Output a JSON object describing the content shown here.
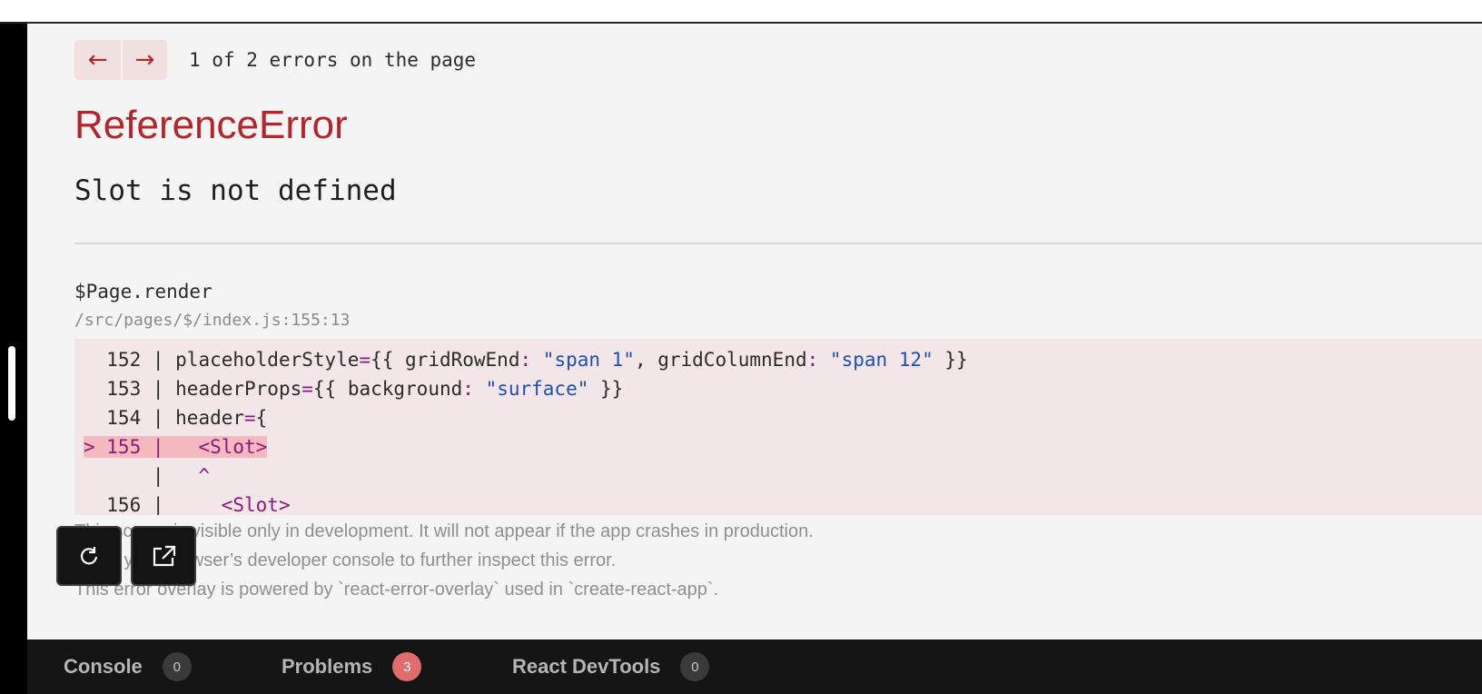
{
  "navigation": {
    "prev_symbol": "←",
    "next_symbol": "→",
    "status": "1 of 2 errors on the page"
  },
  "error": {
    "type": "ReferenceError",
    "message": "Slot is not defined"
  },
  "frame": {
    "function": "$Page.render",
    "location": "/src/pages/$/index.js:155:13"
  },
  "code_lines": [
    {
      "gutter": "  152 | ",
      "segments": [
        [
          "placeholderStyle",
          ""
        ],
        [
          "=",
          "kw"
        ],
        [
          "{{ gridRowEnd",
          ""
        ],
        [
          ":",
          "kw"
        ],
        [
          " ",
          ""
        ],
        [
          "\"span 1\"",
          "str"
        ],
        [
          ", gridColumnEnd",
          ""
        ],
        [
          ":",
          "kw"
        ],
        [
          " ",
          ""
        ],
        [
          "\"span 12\"",
          "str"
        ],
        [
          " }}",
          ""
        ]
      ]
    },
    {
      "gutter": "  153 | ",
      "segments": [
        [
          "headerProps",
          ""
        ],
        [
          "=",
          "kw"
        ],
        [
          "{{ background",
          ""
        ],
        [
          ":",
          "kw"
        ],
        [
          " ",
          ""
        ],
        [
          "\"surface\"",
          "str"
        ],
        [
          " }}",
          ""
        ]
      ]
    },
    {
      "gutter": "  154 | ",
      "segments": [
        [
          "header",
          ""
        ],
        [
          "=",
          "kw"
        ],
        [
          "{",
          ""
        ]
      ]
    },
    {
      "gutter": "> 155 | ",
      "highlight": true,
      "segments": [
        [
          "  ",
          ""
        ],
        [
          "<Slot>",
          "kw"
        ]
      ]
    },
    {
      "gutter": "      | ",
      "segments": [
        [
          "  ",
          ""
        ],
        [
          "^",
          "kw"
        ]
      ]
    },
    {
      "gutter": "  156 | ",
      "segments": [
        [
          "    ",
          ""
        ],
        [
          "<Slot>",
          "kw"
        ]
      ]
    }
  ],
  "footnotes": [
    "This screen is visible only in development. It will not appear if the app crashes in production.",
    "Open your browser’s developer console to further inspect this error.",
    "This error overlay is powered by `react-error-overlay` used in `create-react-app`."
  ],
  "floating_buttons": [
    {
      "name": "refresh-icon"
    },
    {
      "name": "open-external-icon"
    }
  ],
  "devtools": {
    "tabs": [
      {
        "label": "Console",
        "count": "0",
        "alert": false
      },
      {
        "label": "Problems",
        "count": "3",
        "alert": true
      },
      {
        "label": "React DevTools",
        "count": "0",
        "alert": false
      }
    ]
  },
  "colors": {
    "error_red": "#b3252b",
    "overlay_bg": "#f4f4f4",
    "code_bg": "#f3e6e8",
    "highlight_bg": "#f3b9be",
    "keyword": "#8a1a7a",
    "string": "#1f4fb0",
    "alert_badge": "#e06c6c"
  }
}
